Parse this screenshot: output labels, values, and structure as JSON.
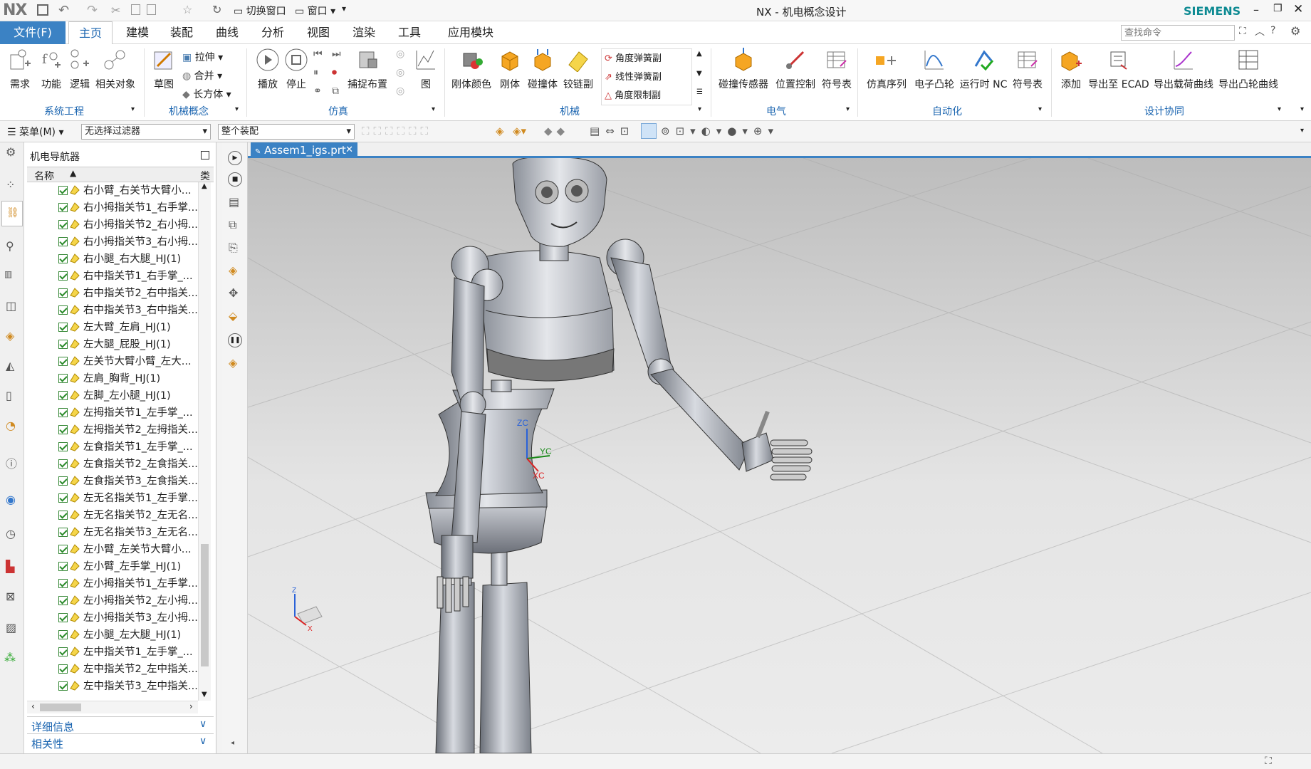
{
  "title": "NX - 机电概念设计",
  "brand": "SIEMENS",
  "app_logo": "NX",
  "menus": [
    "文件(F)",
    "主页",
    "建模",
    "装配",
    "曲线",
    "分析",
    "视图",
    "渲染",
    "工具",
    "应用模块"
  ],
  "search_placeholder": "查找命令",
  "ribbon": {
    "sys_buttons": [
      "需求",
      "功能",
      "逻辑",
      "相关对象"
    ],
    "mech_concept": {
      "sketch": "草图",
      "extrude": "拉伸",
      "unite": "合并",
      "block": "长方体"
    },
    "sim_buttons": [
      "播放",
      "停止",
      "捕捉布置",
      "图"
    ],
    "mech_buttons": [
      "刚体颜色",
      "刚体",
      "碰撞体",
      "铰链副"
    ],
    "mech_list": [
      "角度弹簧副",
      "线性弹簧副",
      "角度限制副"
    ],
    "elec_buttons": [
      "碰撞传感器",
      "位置控制",
      "符号表"
    ],
    "auto_buttons": [
      "仿真序列",
      "电子凸轮",
      "运行时 NC",
      "符号表"
    ],
    "design_buttons": [
      "添加",
      "导出至 ECAD",
      "导出载荷曲线",
      "导出凸轮曲线"
    ],
    "groups": [
      "系统工程",
      "机械概念",
      "仿真",
      "机械",
      "电气",
      "自动化",
      "设计协同"
    ]
  },
  "toolbar2": {
    "menu": "菜单(M)",
    "filter": "无选择过滤器",
    "assembly": "整个装配"
  },
  "navigator": {
    "title": "机电导航器",
    "col_name": "名称",
    "col_type": "类",
    "rows": [
      "右小臂_右关节大臂小...",
      "右小拇指关节1_右手掌...",
      "右小拇指关节2_右小拇...",
      "右小拇指关节3_右小拇...",
      "右小腿_右大腿_HJ(1)",
      "右中指关节1_右手掌_...",
      "右中指关节2_右中指关...",
      "右中指关节3_右中指关...",
      "左大臂_左肩_HJ(1)",
      "左大腿_屁股_HJ(1)",
      "左关节大臂小臂_左大...",
      "左肩_胸背_HJ(1)",
      "左脚_左小腿_HJ(1)",
      "左拇指关节1_左手掌_...",
      "左拇指关节2_左拇指关...",
      "左食指关节1_左手掌_...",
      "左食指关节2_左食指关...",
      "左食指关节3_左食指关...",
      "左无名指关节1_左手掌...",
      "左无名指关节2_左无名...",
      "左无名指关节3_左无名...",
      "左小臂_左关节大臂小...",
      "左小臂_左手掌_HJ(1)",
      "左小拇指关节1_左手掌...",
      "左小拇指关节2_左小拇...",
      "左小拇指关节3_左小拇...",
      "左小腿_左大腿_HJ(1)",
      "左中指关节1_左手掌_...",
      "左中指关节2_左中指关...",
      "左中指关节3_左中指关..."
    ],
    "details": "详细信息",
    "relations": "相关性"
  },
  "doc_tab": "Assem1_igs.prt",
  "axes": {
    "zc": "ZC",
    "yc": "YC",
    "xc": "XC",
    "z": "Z",
    "x": "X"
  },
  "colors": {
    "accent": "#3b82c4",
    "group_label": "#1b65b0",
    "brand": "#0d8a92"
  }
}
